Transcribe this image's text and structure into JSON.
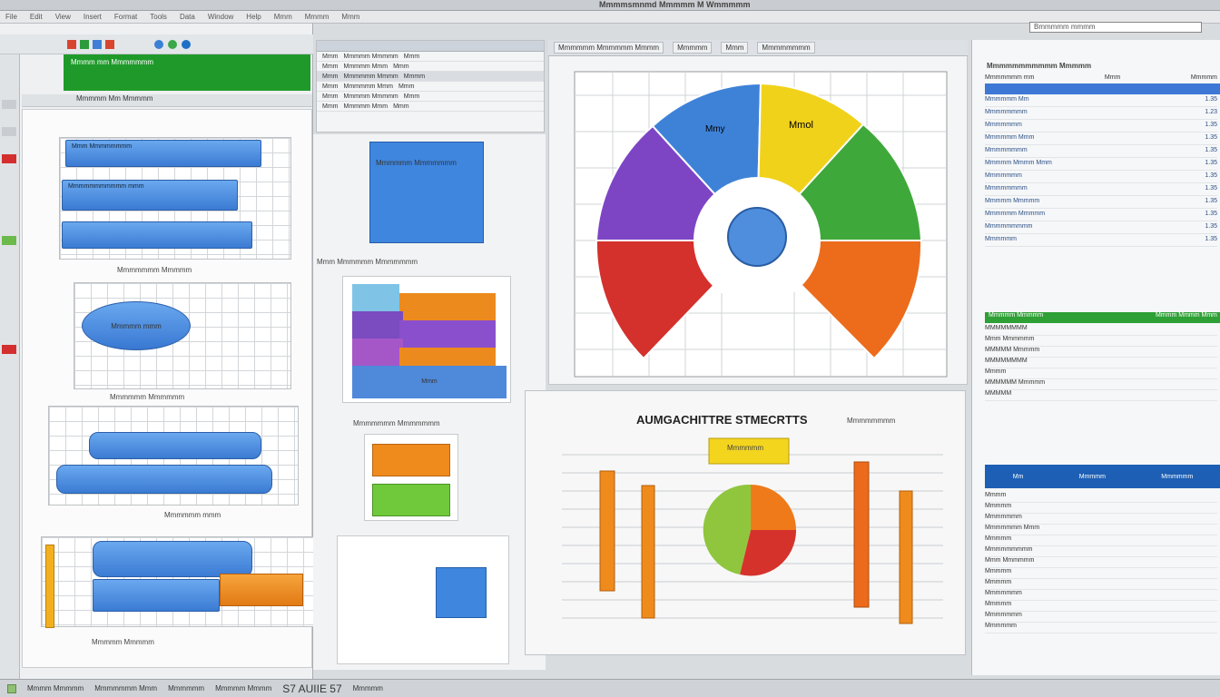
{
  "window": {
    "title": "Mmmmsmnmd Mmmmm M Wmmmmm",
    "search_text": "Bmmmmm mmmm"
  },
  "menu": {
    "items": [
      "File",
      "Edit",
      "View",
      "Insert",
      "Format",
      "Tools",
      "Data",
      "Window",
      "Help",
      "Mmm",
      "Mmmm",
      "Mmm"
    ]
  },
  "left": {
    "green_label": "Mmmm mm Mmmmmmm",
    "row_label": "Mmmmm Mm Mmmmm",
    "chart1_title": "Mmm Mmmmmmmm",
    "chart1_bar2": "Mmmmmmmmmmm mmm",
    "chart1_caption": "Mmmmmmm Mmmmm",
    "chart2_bubble": "Mmmmm mmm",
    "chart2_caption": "Mmmmmm Mmmmmm",
    "chart3_caption": "Mmmmmm mmm",
    "chart4_caption": "Mmmmm Mmmmm"
  },
  "mid": {
    "table_rows": [
      [
        "Mmm",
        "Mmmmm Mmmmm",
        "Mmm"
      ],
      [
        "Mmm",
        "Mmmmm Mmm",
        "Mmm"
      ],
      [
        "Mmm",
        "Mmmmmm Mmmm",
        "Mmmm"
      ],
      [
        "Mmm",
        "Mmmmmm Mmm",
        "Mmm"
      ],
      [
        "Mmm",
        "Mmmmm Mmmmm",
        "Mmm"
      ],
      [
        "Mmm",
        "Mmmmm Mmm",
        "Mmm"
      ]
    ],
    "box_label": "Mmmmmm Mmmmmmm",
    "box_caption": "Mmm Mmmmmm Mmmmmmm",
    "stack_label": "Mmm",
    "chart_caption": "Mmmmmmm Mmmmmmm"
  },
  "center": {
    "tabs": [
      "Mmmmmm Mmmmmm Mmmm",
      "Mmmmm",
      "Mmm",
      "Mmmmmmmm"
    ],
    "seg_blue": "Mmy",
    "seg_yellow": "Mmol"
  },
  "bottom": {
    "title": "AUMGACHITTRE STMECRTTS",
    "subtitle": "Mmmmmmmm",
    "legend_label": "Mmmmmm"
  },
  "right": {
    "title": "Mmmmmmmmmmm Mmmmm",
    "header": [
      "Mmmmmmm mm",
      "Mmm",
      "Mmmmm"
    ],
    "rows": [
      [
        "Mmmmmm Mm",
        "1.35"
      ],
      [
        "Mmmmmmmm",
        "1.23"
      ],
      [
        "Mmmmmmm",
        "1.35"
      ],
      [
        "Mmmmmm Mmm",
        "1.35"
      ],
      [
        "Mmmmmmmm",
        "1.35"
      ],
      [
        "Mmmmm Mmmm Mmm",
        "1.35"
      ],
      [
        "Mmmmmmm",
        "1.35"
      ],
      [
        "Mmmmmmmm",
        "1.35"
      ],
      [
        "Mmmmm Mmmmm",
        "1.35"
      ],
      [
        "Mmmmmm Mmmmm",
        "1.35"
      ],
      [
        "Mmmmmmmmm",
        "1.35"
      ],
      [
        "Mmmmmm",
        "1.35"
      ]
    ],
    "green_header": [
      "Mmmmm Mmmmm",
      "Mmmm Mmmm Mmm"
    ],
    "green_rows": [
      "MMMMMMMM",
      "Mmm Mmmmmm",
      "MMMMM Mmmmm",
      "MMMMMMMM",
      "Mmmm",
      "MMMMMM Mmmmm",
      "MMMMM"
    ],
    "blue_header": [
      "Mm",
      "Mmmmm",
      "Mmmmmm"
    ],
    "blue_rows": [
      "Mmmm",
      "Mmmmm",
      "Mmmmmmm",
      "Mmmmmmm Mmm",
      "Mmmmm",
      "Mmmmmmmmm",
      "Mmm Mmmmmm",
      "Mmmmm",
      "Mmmmm",
      "Mmmmmmm",
      "Mmmmm",
      "Mmmmmmm",
      "Mmmmmm"
    ]
  },
  "status": {
    "items": [
      "Mmmm Mmmmm",
      "Mmmmmmm Mmm",
      "Mmmmmm",
      "Mmmmm Mmmm",
      "S7 AUIIE 57",
      "Mmmmm"
    ]
  },
  "colors": {
    "blue": "#3f83dc",
    "green": "#2da134",
    "orange": "#ec7a1e",
    "yellow": "#f5d21c",
    "red": "#d6332d",
    "purple": "#7f46c2"
  }
}
